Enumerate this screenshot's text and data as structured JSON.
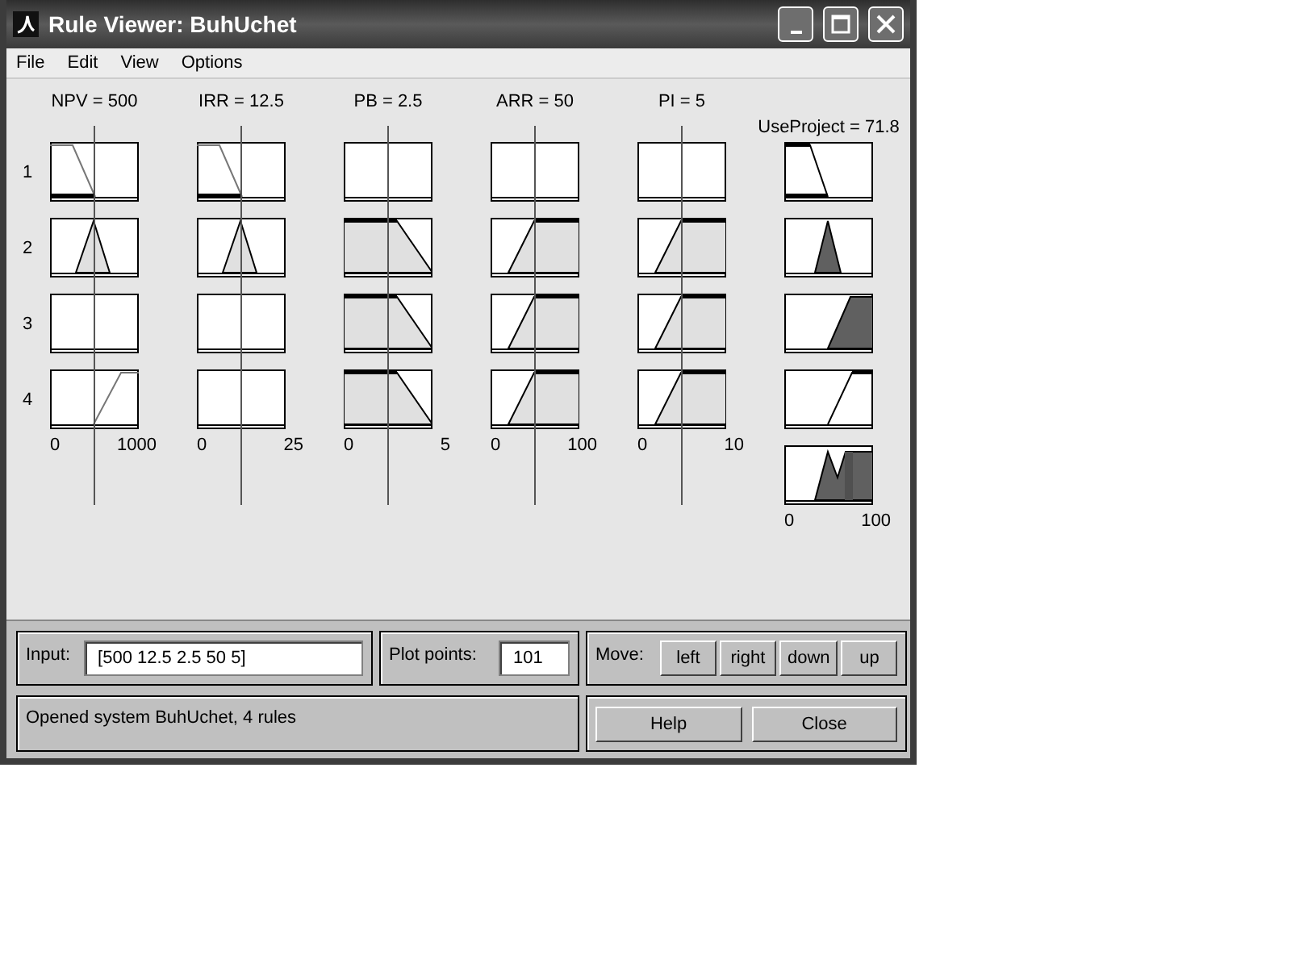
{
  "window": {
    "title": "Rule Viewer: BuhUchet"
  },
  "menu": [
    "File",
    "Edit",
    "View",
    "Options"
  ],
  "rule_numbers": [
    "1",
    "2",
    "3",
    "4"
  ],
  "inputs": [
    {
      "label": "NPV = 500",
      "ticks": [
        "0",
        "1000"
      ],
      "cells": [
        {
          "kind": "falling-gray"
        },
        {
          "kind": "triangle"
        },
        {
          "kind": "empty"
        },
        {
          "kind": "rising-gray"
        }
      ]
    },
    {
      "label": "IRR = 12.5",
      "ticks": [
        "0",
        "25"
      ],
      "cells": [
        {
          "kind": "falling-gray"
        },
        {
          "kind": "triangle"
        },
        {
          "kind": "empty"
        },
        {
          "kind": "empty"
        }
      ]
    },
    {
      "label": "PB = 2.5",
      "ticks": [
        "0",
        "5"
      ],
      "cells": [
        {
          "kind": "empty"
        },
        {
          "kind": "trapezoid"
        },
        {
          "kind": "trapezoid"
        },
        {
          "kind": "trapezoid"
        }
      ]
    },
    {
      "label": "ARR = 50",
      "ticks": [
        "0",
        "100"
      ],
      "cells": [
        {
          "kind": "empty"
        },
        {
          "kind": "rising"
        },
        {
          "kind": "rising"
        },
        {
          "kind": "rising"
        }
      ]
    },
    {
      "label": "PI = 5",
      "ticks": [
        "0",
        "10"
      ],
      "cells": [
        {
          "kind": "empty"
        },
        {
          "kind": "rising"
        },
        {
          "kind": "rising"
        },
        {
          "kind": "rising"
        }
      ]
    }
  ],
  "output": {
    "label": "UseProject = 71.8",
    "level": 0.718,
    "ticks": [
      "0",
      "100"
    ],
    "cells": [
      {
        "kind": "falling"
      },
      {
        "kind": "triangle-dark"
      },
      {
        "kind": "ramp-dark"
      },
      {
        "kind": "rising-outline"
      },
      {
        "kind": "aggregate"
      }
    ]
  },
  "input_field": {
    "label": "Input:",
    "value": "[500 12.5 2.5 50 5]"
  },
  "plot_points": {
    "label": "Plot points:",
    "value": "101"
  },
  "move": {
    "label": "Move:",
    "buttons": [
      "left",
      "right",
      "down",
      "up"
    ]
  },
  "status": "Opened system BuhUchet, 4 rules",
  "buttons": [
    "Help",
    "Close"
  ]
}
